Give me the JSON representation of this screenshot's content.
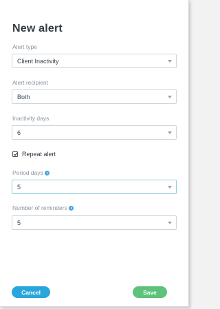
{
  "dialog": {
    "title": "New alert"
  },
  "fields": {
    "alert_type": {
      "label": "Alert type",
      "value": "Client Inactivity"
    },
    "alert_recipient": {
      "label": "Alert recipient",
      "value": "Both"
    },
    "inactivity_days": {
      "label": "Inactivity days",
      "value": "6"
    },
    "repeat_alert": {
      "label": "Repeat alert",
      "checked": true
    },
    "period_days": {
      "label": "Period days",
      "value": "5"
    },
    "number_of_reminders": {
      "label": "Number of reminders",
      "value": "5"
    }
  },
  "actions": {
    "cancel_label": "Cancel",
    "save_label": "Save"
  },
  "colors": {
    "cancel": "#29a6dc",
    "save": "#5cc27c",
    "info_icon": "#4aa3df"
  }
}
